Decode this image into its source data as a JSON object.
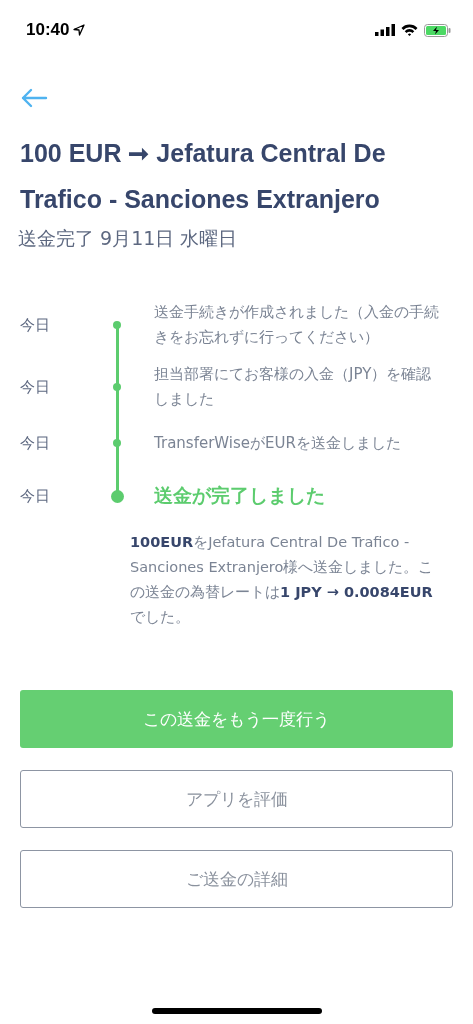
{
  "status_bar": {
    "time": "10:40"
  },
  "title": "100 EUR ➞ Jefatura Central De Trafico - Sanciones Extranjero",
  "subtitle": "送金完了 9月11日 水曜日",
  "timeline": [
    {
      "kind": "step",
      "date": "今日",
      "text": "送金手続きが作成されました（入金の手続きをお忘れずに行ってください）"
    },
    {
      "kind": "step",
      "date": "今日",
      "text": "担当部署にてお客様の入金（JPY）を確認しました"
    },
    {
      "kind": "step",
      "date": "今日",
      "text": "TransferWiseがEURを送金しました"
    },
    {
      "kind": "final",
      "date": "今日",
      "text": "送金が完了しました"
    }
  ],
  "description": "**100EUR**をJefatura Central De Trafico - Sanciones Extranjero様へ送金しました。この送金の為替レートは**1 JPY → 0.0084EUR**でした。",
  "buttons": [
    {
      "kind": "primary",
      "label": "この送金をもう一度行う"
    },
    {
      "kind": "outline",
      "label": "アプリを評価"
    },
    {
      "kind": "outline",
      "label": "ご送金の詳細"
    }
  ]
}
